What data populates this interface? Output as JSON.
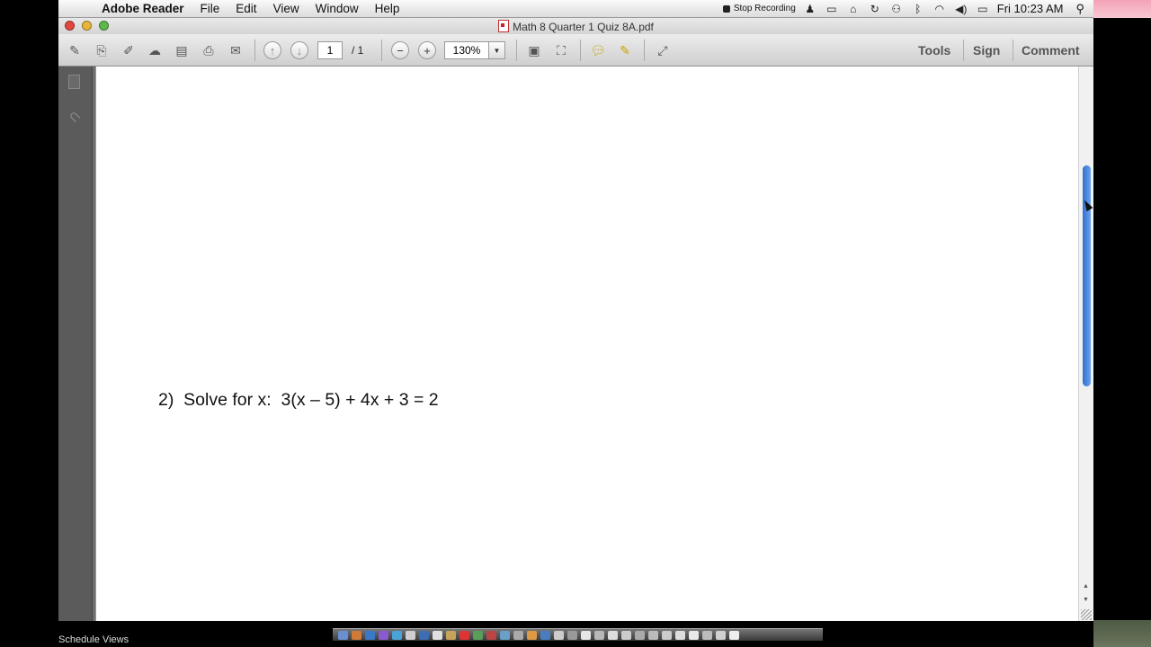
{
  "menubar": {
    "app_name": "Adobe Reader",
    "menus": [
      "File",
      "Edit",
      "View",
      "Window",
      "Help"
    ],
    "recording_label": "Stop Recording",
    "clock": "Fri 10:23 AM"
  },
  "window": {
    "title": "Math 8 Quarter 1 Quiz 8A.pdf"
  },
  "toolbar": {
    "page_current": "1",
    "page_total": "/  1",
    "zoom": "130%",
    "tools_label": "Tools",
    "sign_label": "Sign",
    "comment_label": "Comment"
  },
  "document": {
    "question": "2)  Solve for x:  3(x – 5) + 4x + 3 = 2"
  },
  "dock": {
    "status_label": "Schedule Views"
  },
  "colors": {
    "scroll_thumb": "#3b7fe0",
    "close_light": "#e2463f",
    "minimize_light": "#e8b53a",
    "zoom_light": "#5cb848"
  }
}
